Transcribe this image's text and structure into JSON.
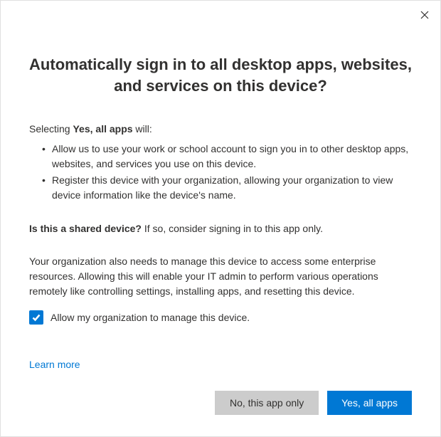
{
  "title": "Automatically sign in to all desktop apps, websites, and services on this device?",
  "intro": {
    "prefix": "Selecting ",
    "bold": "Yes, all apps",
    "suffix": " will:"
  },
  "bullets": [
    "Allow us to use your work or school account to sign you in to other desktop apps, websites, and services you use on this device.",
    "Register this device with your organization, allowing your organization to view device information like the device's name."
  ],
  "shared": {
    "bold": "Is this a shared device?",
    "rest": " If so, consider signing in to this app only."
  },
  "org_text": "Your organization also needs to manage this device to access some enterprise resources. Allowing this will enable your IT admin to perform various operations remotely like controlling settings, installing apps, and resetting this device.",
  "checkbox": {
    "checked": true,
    "label": "Allow my organization to manage this device."
  },
  "learn_more": "Learn more",
  "buttons": {
    "secondary": "No, this app only",
    "primary": "Yes, all apps"
  }
}
